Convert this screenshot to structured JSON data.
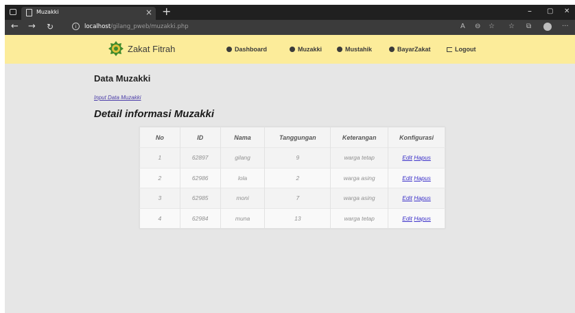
{
  "browser": {
    "tab_title": "Muzakki",
    "tab_close": "×",
    "new_tab": "+",
    "url_host": "localhost",
    "url_path": "/gilang_pweb/muzakki.php",
    "window_controls": [
      "–",
      "▢",
      "✕"
    ]
  },
  "header": {
    "brand": "Zakat Fitrah",
    "nav": [
      "Dashboard",
      "Muzakki",
      "Mustahik",
      "BayarZakat"
    ],
    "logout": "Logout"
  },
  "main": {
    "page_title": "Data Muzakki",
    "input_link": "Input Data Muzakki",
    "section_title": "Detail informasi Muzakki",
    "table": {
      "columns": [
        "No",
        "ID",
        "Nama",
        "Tanggungan",
        "Keterangan",
        "Konfigurasi"
      ],
      "rows": [
        {
          "no": "1",
          "id": "62897",
          "nama": "gilang",
          "tanggungan": "9",
          "keterangan": "warga tetap"
        },
        {
          "no": "2",
          "id": "62986",
          "nama": "lola",
          "tanggungan": "2",
          "keterangan": "warga asing"
        },
        {
          "no": "3",
          "id": "62985",
          "nama": "moni",
          "tanggungan": "7",
          "keterangan": "warga asing"
        },
        {
          "no": "4",
          "id": "62984",
          "nama": "muna",
          "tanggungan": "13",
          "keterangan": "warga tetap"
        }
      ],
      "edit_label": "Edit",
      "delete_label": "Hapus"
    }
  },
  "colors": {
    "header_bg": "#fcec9a",
    "page_bg": "#e6e6e6",
    "link": "#3a2fc9"
  }
}
